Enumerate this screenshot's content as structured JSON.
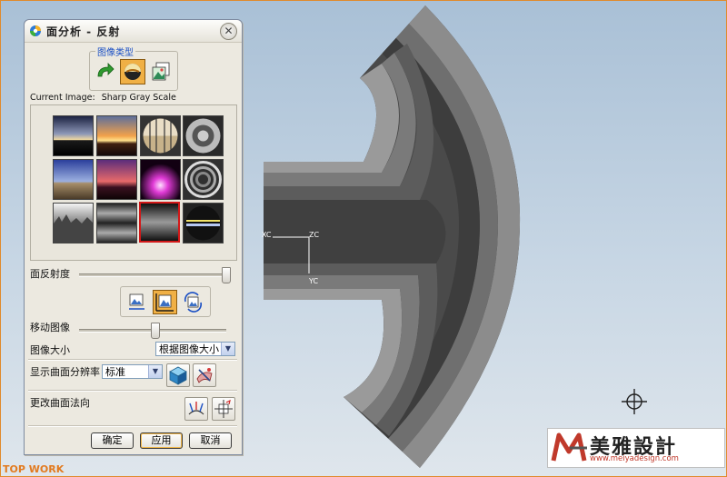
{
  "dialog": {
    "title": "面分析 - 反射",
    "close": "✕",
    "image_type_label": "图像类型",
    "current_image_label": "Current Image:",
    "current_image_value": "Sharp Gray Scale",
    "thumbnails": [
      "sunset-horizon",
      "orange-sunset",
      "striped-sphere",
      "checker-sphere",
      "blue-sky-plain",
      "red-sky",
      "magenta-sphere",
      "ring-sphere",
      "grass-field",
      "horizontal-bands",
      "gray-gradient-selected",
      "dark-sphere-bands"
    ],
    "reflectivity_label": "面反射度",
    "reflectivity_value": 1.0,
    "move_image_label": "移动图像",
    "move_image_value": 0.5,
    "image_size_label": "图像大小",
    "image_size_value": "根据图像大小",
    "resolution_label": "显示曲面分辨率",
    "resolution_value": "标准",
    "normal_label": "更改曲面法向",
    "ok_label": "确定",
    "apply_label": "应用",
    "cancel_label": "取消"
  },
  "viewport": {
    "axis_x": "XC",
    "axis_y": "YC",
    "axis_z": "ZC"
  },
  "logo": {
    "brand": "美雅設計",
    "url": "www.meiyadesign.com"
  },
  "corner_tag": "TOP WORK",
  "colors": {
    "accent_orange": "#f0b045",
    "selection_red": "#d21818",
    "group_label_blue": "#1a4fc4"
  }
}
